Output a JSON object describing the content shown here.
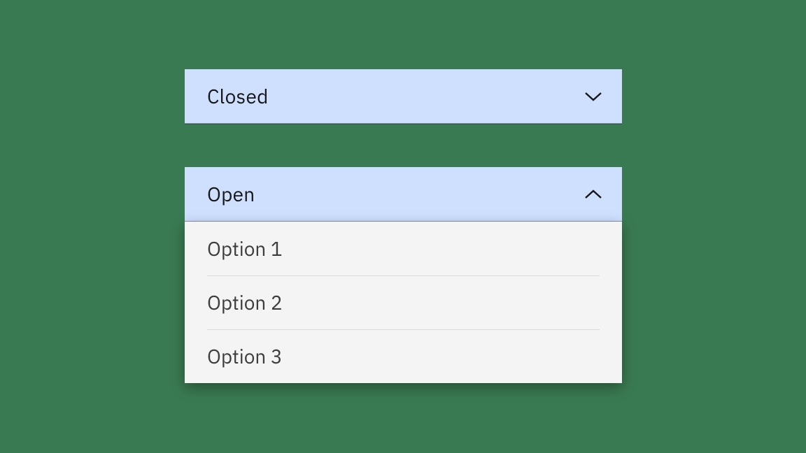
{
  "colors": {
    "background": "#3a7a52",
    "fieldFill": "#cfe0ff",
    "menuFill": "#f4f4f4",
    "text": "#161616",
    "optionText": "#3d3d3d"
  },
  "closedDropdown": {
    "label": "Closed",
    "chevronIcon": "chevron-down"
  },
  "openDropdown": {
    "label": "Open",
    "chevronIcon": "chevron-up",
    "options": [
      {
        "label": "Option 1"
      },
      {
        "label": "Option 2"
      },
      {
        "label": "Option 3"
      }
    ]
  }
}
